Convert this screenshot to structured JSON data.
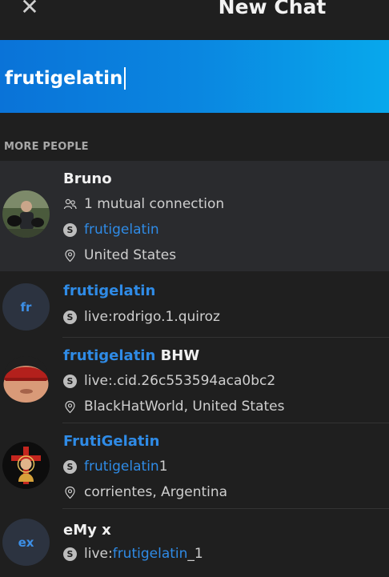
{
  "header": {
    "close_glyph": "✕",
    "title": "New Chat"
  },
  "search": {
    "value": "frutigelatin"
  },
  "section": {
    "label": "MORE PEOPLE"
  },
  "results": [
    {
      "name": "Bruno",
      "mutual": "1 mutual connection",
      "skype_id": "frutigelatin",
      "location": "United States"
    },
    {
      "initials": "fr",
      "name": "frutigelatin",
      "skype_id": "live:rodrigo.1.quiroz"
    },
    {
      "name_highlight": "frutigelatin",
      "name_rest": " BHW",
      "skype_id": "live:.cid.26c553594aca0bc2",
      "location": "BlackHatWorld, United States"
    },
    {
      "name": "FrutiGelatin",
      "skype_id_highlight": "frutigelatin",
      "skype_id_rest": "1",
      "location": "corrientes, Argentina"
    },
    {
      "initials": "ex",
      "name": "eMy x",
      "skype_prefix": "live:",
      "skype_id_highlight": "frutigelatin",
      "skype_id_rest": "_1"
    }
  ],
  "colors": {
    "accent": "#2f8be6",
    "search_bar_start": "#0a73d8",
    "search_bar_end": "#08a8ec",
    "background": "#1f1f1f",
    "selected_row": "#2a2b2e"
  },
  "icons": {
    "close": "close-icon",
    "mutual": "people-icon",
    "skype": "skype-icon",
    "location": "location-pin-icon"
  }
}
